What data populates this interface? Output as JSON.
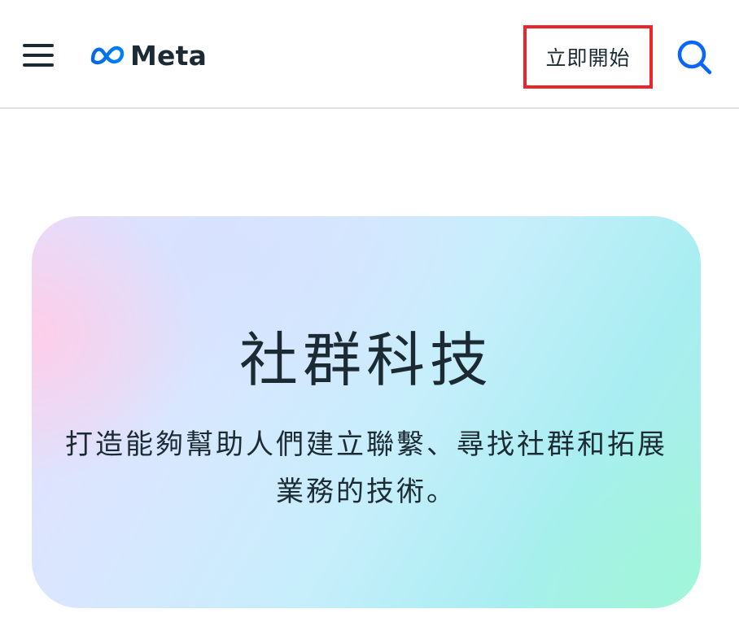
{
  "header": {
    "menu_icon": "hamburger-menu-icon",
    "logo_text": "Meta",
    "logo_icon": "meta-infinity-logo",
    "cta_label": "立即開始",
    "search_icon": "search-icon",
    "accent_color": "#0866ff",
    "highlight_border_color": "#e8262c"
  },
  "hero": {
    "title": "社群科技",
    "description": "打造能夠幫助人們建立聯繫、尋找社群和拓展業務的技術。"
  }
}
